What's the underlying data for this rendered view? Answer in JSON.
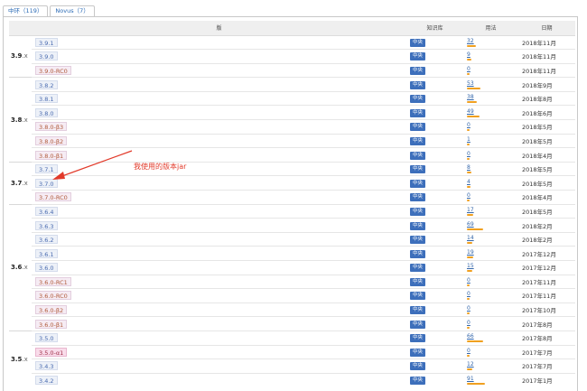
{
  "tabs": [
    {
      "label": "中环（119）",
      "active": true
    },
    {
      "label": "Novus（7）",
      "active": false
    }
  ],
  "table": {
    "headers": {
      "version": "版",
      "repository": "知识库",
      "usages": "用法",
      "date": "日期"
    },
    "groups": [
      {
        "label": "3.9",
        "suffix": ".x",
        "rows": [
          {
            "version": "3.9.1",
            "repo": "中央",
            "usages": "32",
            "date": "2018年11月",
            "pre": false
          },
          {
            "version": "3.9.0",
            "repo": "中央",
            "usages": "9",
            "date": "2018年11月",
            "pre": false
          },
          {
            "version": "3.9.0-RC0",
            "repo": "中央",
            "usages": "0",
            "date": "2018年11月",
            "pre": true
          }
        ]
      },
      {
        "label": "3.8",
        "suffix": ".x",
        "rows": [
          {
            "version": "3.8.2",
            "repo": "中央",
            "usages": "53",
            "date": "2018年9月",
            "pre": false
          },
          {
            "version": "3.8.1",
            "repo": "中央",
            "usages": "38",
            "date": "2018年8月",
            "pre": false
          },
          {
            "version": "3.8.0",
            "repo": "中央",
            "usages": "49",
            "date": "2018年6月",
            "pre": false
          },
          {
            "version": "3.8.0-β3",
            "repo": "中央",
            "usages": "0",
            "date": "2018年5月",
            "pre": true
          },
          {
            "version": "3.8.0-β2",
            "repo": "中央",
            "usages": "1",
            "date": "2018年5月",
            "pre": true
          },
          {
            "version": "3.8.0-β1",
            "repo": "中央",
            "usages": "0",
            "date": "2018年4月",
            "pre": true
          }
        ]
      },
      {
        "label": "3.7",
        "suffix": ".x",
        "rows": [
          {
            "version": "3.7.1",
            "repo": "中央",
            "usages": "8",
            "date": "2018年5月",
            "pre": false
          },
          {
            "version": "3.7.0",
            "repo": "中央",
            "usages": "4",
            "date": "2018年5月",
            "pre": false
          },
          {
            "version": "3.7.0-RC0",
            "repo": "中央",
            "usages": "0",
            "date": "2018年4月",
            "pre": true
          }
        ]
      },
      {
        "label": "3.6",
        "suffix": ".x",
        "rows": [
          {
            "version": "3.6.4",
            "repo": "中央",
            "usages": "17",
            "date": "2018年5月",
            "pre": false
          },
          {
            "version": "3.6.3",
            "repo": "中央",
            "usages": "69",
            "date": "2018年2月",
            "pre": false
          },
          {
            "version": "3.6.2",
            "repo": "中央",
            "usages": "14",
            "date": "2018年2月",
            "pre": false
          },
          {
            "version": "3.6.1",
            "repo": "中央",
            "usages": "19",
            "date": "2017年12月",
            "pre": false
          },
          {
            "version": "3.6.0",
            "repo": "中央",
            "usages": "15",
            "date": "2017年12月",
            "pre": false
          },
          {
            "version": "3.6.0-RC1",
            "repo": "中央",
            "usages": "0",
            "date": "2017年11月",
            "pre": true
          },
          {
            "version": "3.6.0-RC0",
            "repo": "中央",
            "usages": "0",
            "date": "2017年11月",
            "pre": true
          },
          {
            "version": "3.6.0-β2",
            "repo": "中央",
            "usages": "0",
            "date": "2017年10月",
            "pre": true
          },
          {
            "version": "3.6.0-β1",
            "repo": "中央",
            "usages": "0",
            "date": "2017年8月",
            "pre": true
          }
        ]
      },
      {
        "label": "3.5",
        "suffix": ".x",
        "rows": [
          {
            "version": "3.5.0",
            "repo": "中央",
            "usages": "66",
            "date": "2017年8月",
            "pre": false
          },
          {
            "version": "3.5.0-α1",
            "repo": "中央",
            "usages": "0",
            "date": "2017年7月",
            "pre": true,
            "highlight": true
          },
          {
            "version": "3.4.3",
            "repo": "中央",
            "usages": "12",
            "date": "2017年7月",
            "pre": false
          },
          {
            "version": "3.4.2",
            "repo": "中央",
            "usages": "91",
            "date": "2017年1月",
            "pre": false
          }
        ]
      }
    ]
  },
  "annotation": {
    "text": "我使用的版本jar"
  },
  "colors": {
    "accent": "#3d6fbb",
    "usage_bar": "#f0a020",
    "annotation": "#e23a2a"
  }
}
